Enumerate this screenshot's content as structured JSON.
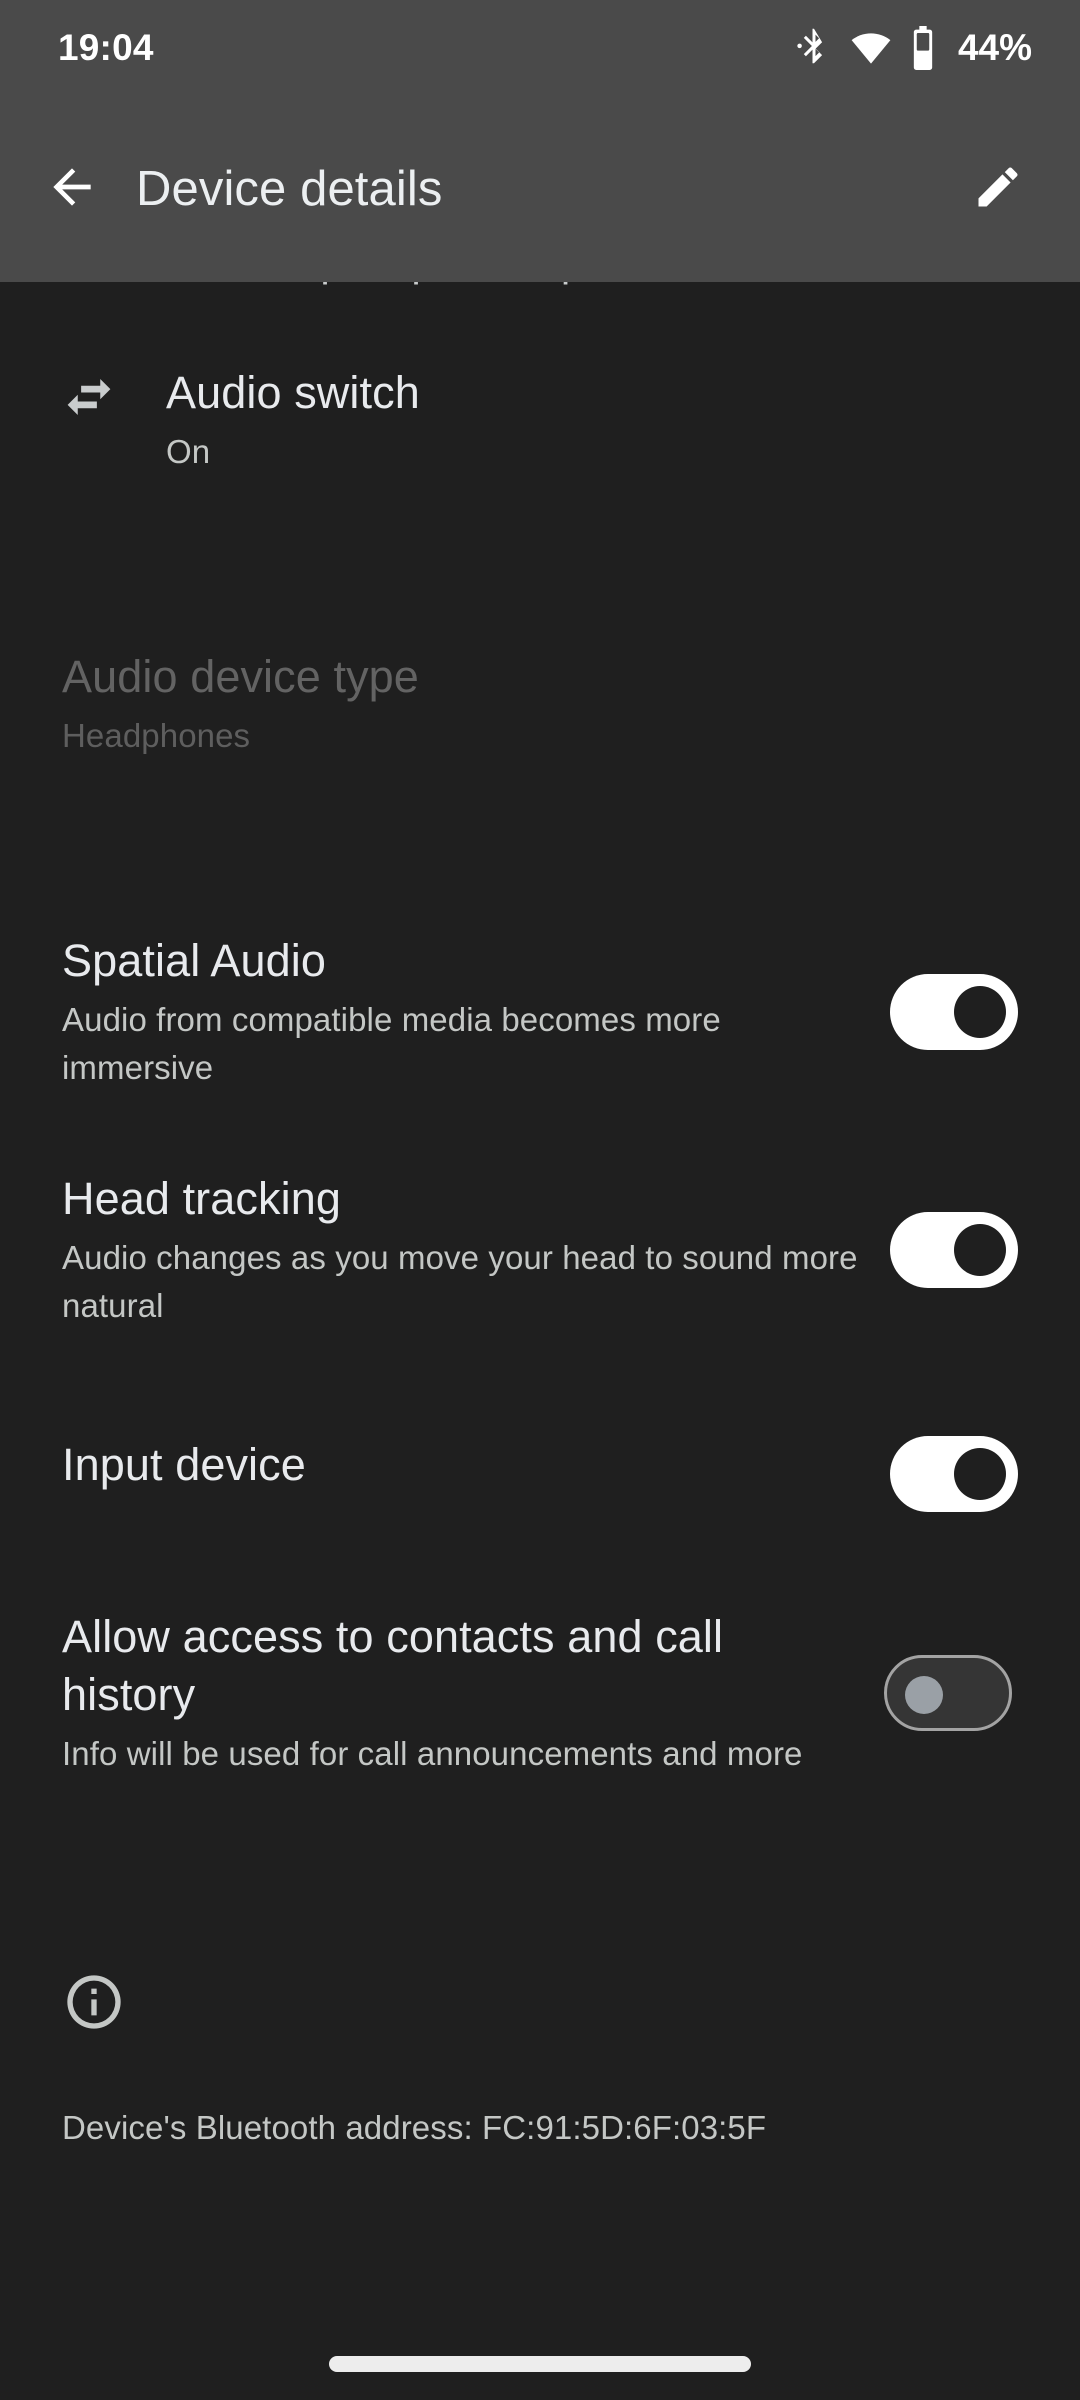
{
  "status_bar": {
    "time": "19:04",
    "battery_percent": "44%",
    "icons": [
      "bluetooth-icon",
      "wifi-icon",
      "battery-icon"
    ]
  },
  "app_bar": {
    "back_label": "back-arrow-icon",
    "title": "Device details",
    "edit_label": "edit-pencil-icon"
  },
  "content": {
    "clipped_top_text": "Tap a speaker, phone, or car",
    "rows": [
      {
        "name": "audio-switch",
        "icon": "swap-arrows-icon",
        "title": "Audio switch",
        "subtitle": "On",
        "has_switch": false,
        "enabled": true
      },
      {
        "name": "audio-device-type",
        "icon": null,
        "title": "Audio device type",
        "subtitle": "Headphones",
        "has_switch": false,
        "enabled": false
      },
      {
        "name": "spatial-audio",
        "icon": null,
        "title": "Spatial Audio",
        "subtitle": "Audio from compatible media becomes more immersive",
        "has_switch": true,
        "switch_state": "on",
        "enabled": true
      },
      {
        "name": "head-tracking",
        "icon": null,
        "title": "Head tracking",
        "subtitle": "Audio changes as you move your head to sound more natural",
        "has_switch": true,
        "switch_state": "on",
        "enabled": true
      },
      {
        "name": "input-device",
        "icon": null,
        "title": "Input device",
        "subtitle": "",
        "has_switch": true,
        "switch_state": "on",
        "enabled": true
      },
      {
        "name": "allow-contacts-call-history",
        "icon": null,
        "title": "Allow access to contacts and call history",
        "subtitle": "Info will be used for call announcements and more",
        "has_switch": true,
        "switch_state": "off",
        "enabled": true
      }
    ],
    "footer": {
      "icon": "info-icon",
      "text": "Device's Bluetooth address: FC:91:5D:6F:03:5F"
    }
  },
  "nav_bar": {
    "pill": "home-gesture-pill"
  },
  "colors": {
    "status_bar_bg": "#4a4a4a",
    "app_bar_bg": "#4a4a4a",
    "content_bg": "#1f1f1f",
    "primary_text": "#e8eaed",
    "secondary_text": "#c4c7c5",
    "disabled_text": "#636363",
    "switch_on_track": "#ffffff",
    "switch_on_thumb": "#1f1f1f",
    "switch_off_track": "#353535",
    "switch_off_thumb": "#9aa0a6",
    "nav_pill": "#ededed"
  }
}
